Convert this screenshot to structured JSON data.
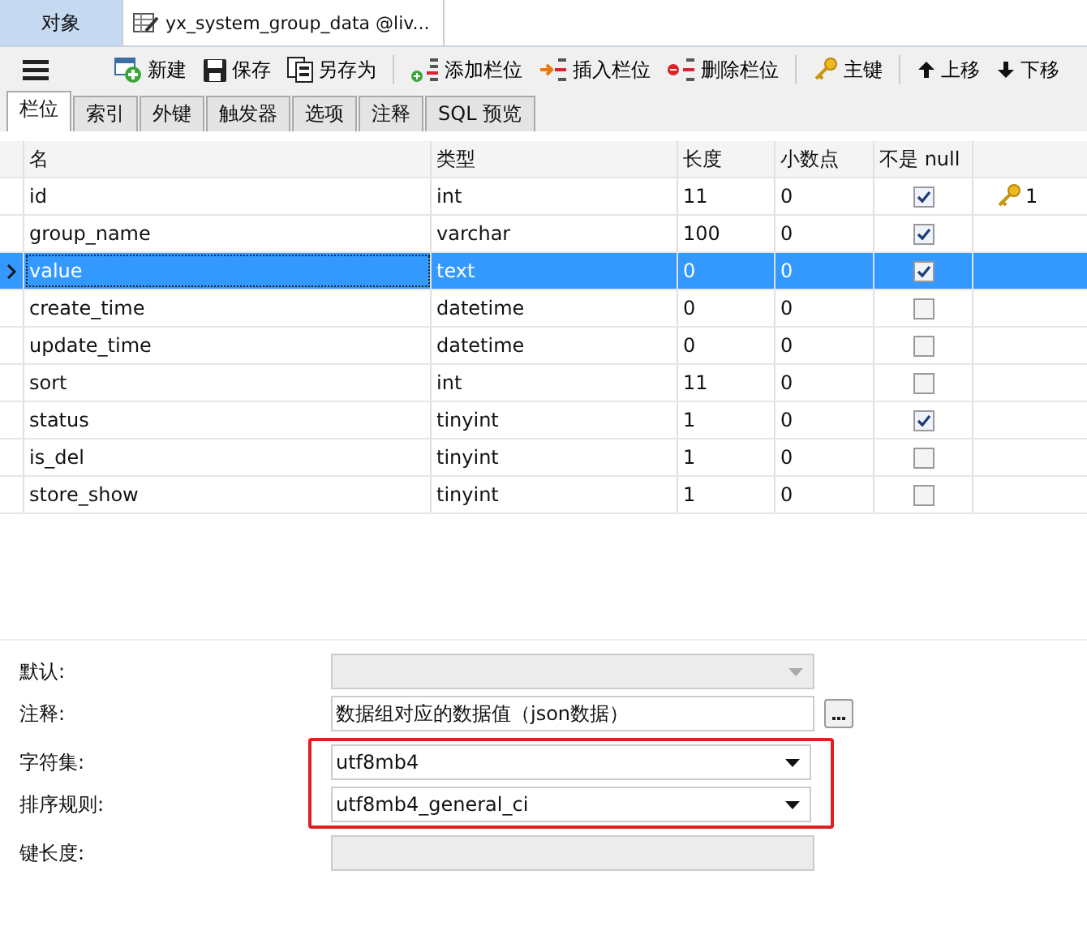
{
  "tabs": [
    {
      "label": "对象",
      "kind": "objects",
      "selected": false
    },
    {
      "label": "yx_system_group_data @liv...",
      "kind": "table",
      "selected": true
    }
  ],
  "toolbar": [
    {
      "kind": "menu"
    },
    {
      "label": "新建",
      "kind": "new"
    },
    {
      "label": "保存",
      "kind": "save"
    },
    {
      "label": "另存为",
      "kind": "saveas"
    },
    {
      "kind": "sep"
    },
    {
      "label": "添加栏位",
      "kind": "addcol"
    },
    {
      "label": "插入栏位",
      "kind": "inscol"
    },
    {
      "label": "删除栏位",
      "kind": "delcol"
    },
    {
      "kind": "sep"
    },
    {
      "label": "主键",
      "kind": "key"
    },
    {
      "kind": "sep"
    },
    {
      "label": "上移",
      "kind": "up"
    },
    {
      "label": "下移",
      "kind": "down"
    }
  ],
  "subtabs": [
    {
      "label": "栏位",
      "selected": true
    },
    {
      "label": "索引",
      "selected": false
    },
    {
      "label": "外键",
      "selected": false
    },
    {
      "label": "触发器",
      "selected": false
    },
    {
      "label": "选项",
      "selected": false
    },
    {
      "label": "注释",
      "selected": false
    },
    {
      "label": "SQL 预览",
      "selected": false
    }
  ],
  "table": {
    "columns": [
      "名",
      "类型",
      "长度",
      "小数点",
      "不是 null"
    ],
    "rows": [
      {
        "name": "id",
        "type": "int",
        "length": "11",
        "decimals": "0",
        "not_null": true,
        "selected": false,
        "key": "1"
      },
      {
        "name": "group_name",
        "type": "varchar",
        "length": "100",
        "decimals": "0",
        "not_null": true,
        "selected": false
      },
      {
        "name": "value",
        "type": "text",
        "length": "0",
        "decimals": "0",
        "not_null": true,
        "selected": true
      },
      {
        "name": "create_time",
        "type": "datetime",
        "length": "0",
        "decimals": "0",
        "not_null": false,
        "selected": false
      },
      {
        "name": "update_time",
        "type": "datetime",
        "length": "0",
        "decimals": "0",
        "not_null": false,
        "selected": false
      },
      {
        "name": "sort",
        "type": "int",
        "length": "11",
        "decimals": "0",
        "not_null": false,
        "selected": false
      },
      {
        "name": "status",
        "type": "tinyint",
        "length": "1",
        "decimals": "0",
        "not_null": true,
        "selected": false
      },
      {
        "name": "is_del",
        "type": "tinyint",
        "length": "1",
        "decimals": "0",
        "not_null": false,
        "selected": false
      },
      {
        "name": "store_show",
        "type": "tinyint",
        "length": "1",
        "decimals": "0",
        "not_null": false,
        "selected": false
      }
    ]
  },
  "properties": [
    {
      "label": "默认:",
      "kind": "combo",
      "disabled": true,
      "highlighted": false
    },
    {
      "label": "注释:",
      "kind": "text",
      "value": "数据组对应的数据值（json数据）",
      "disabled": false,
      "highlighted": false
    },
    {
      "label": "字符集:",
      "kind": "combo",
      "value": "utf8mb4",
      "disabled": false,
      "highlighted": true
    },
    {
      "label": "排序规则:",
      "kind": "combo",
      "value": "utf8mb4_general_ci",
      "disabled": false,
      "highlighted": true
    },
    {
      "label": "键长度:",
      "kind": "field",
      "disabled": true,
      "highlighted": false
    }
  ]
}
